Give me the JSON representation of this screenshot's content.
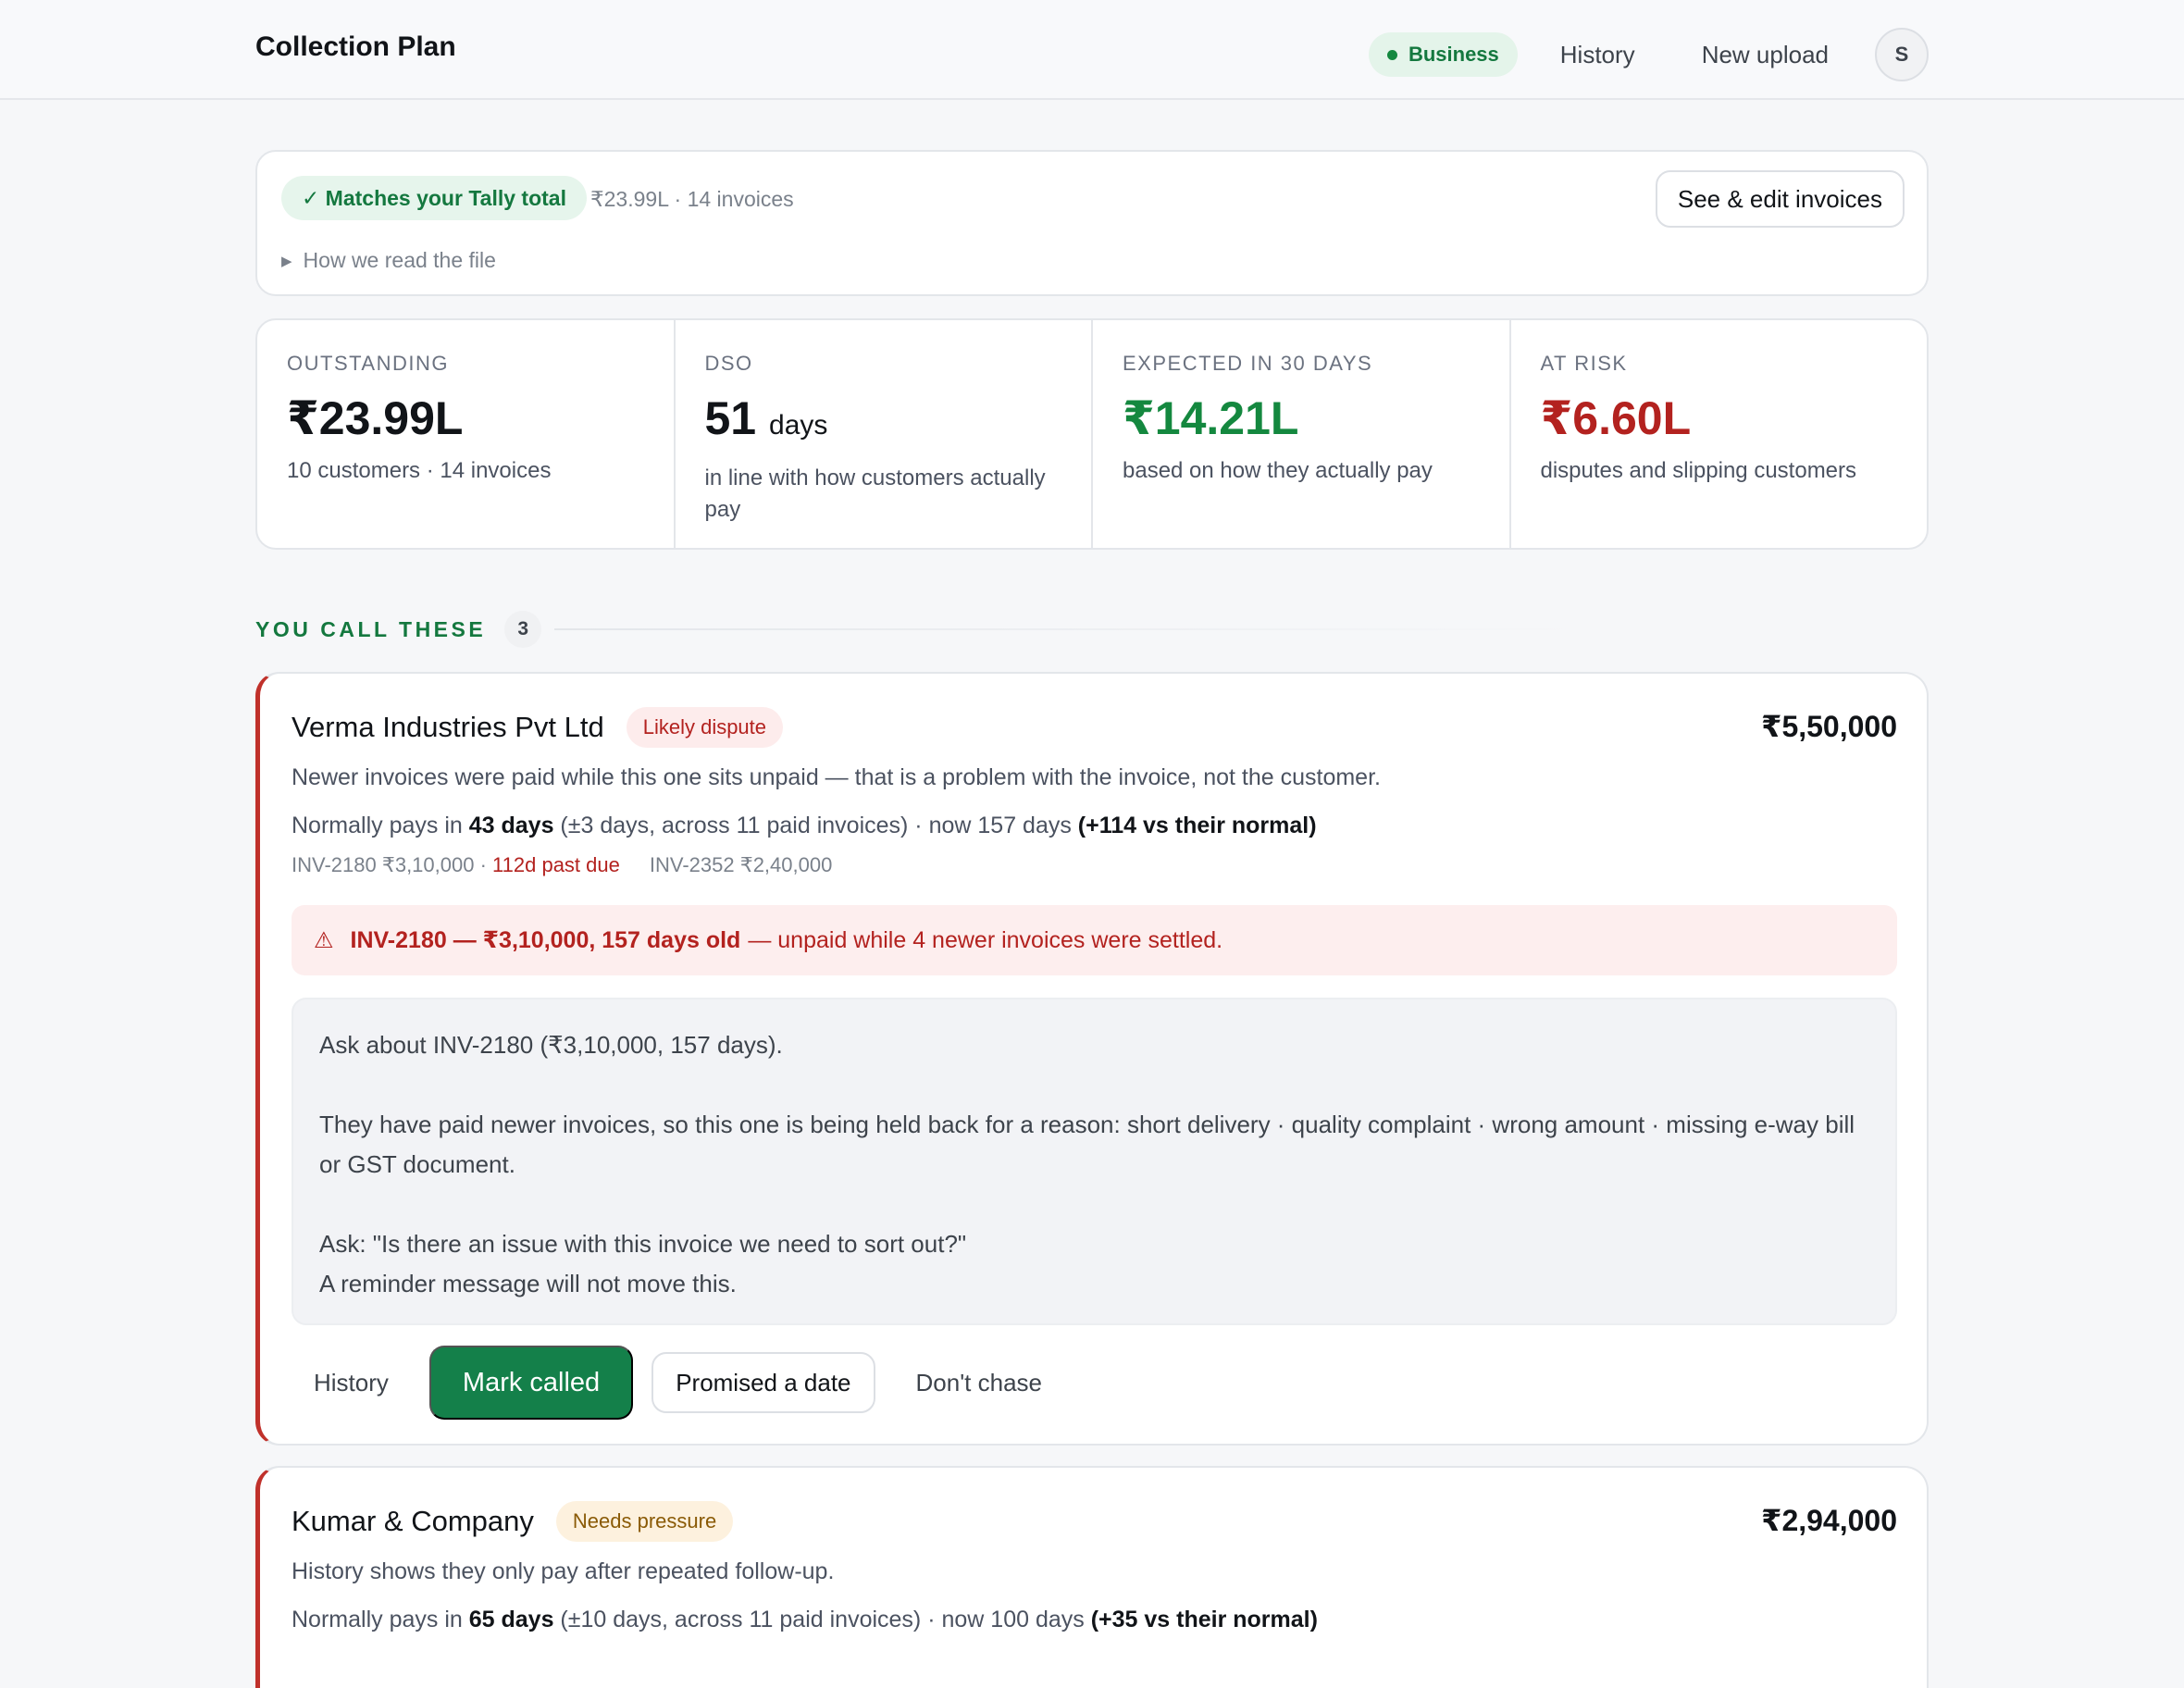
{
  "app": {
    "title": "Collection Plan"
  },
  "nav": {
    "business_label": "Business",
    "history_label": "History",
    "new_upload_label": "New upload",
    "avatar_initial": "S"
  },
  "tally": {
    "match_label": "✓ Matches your Tally total",
    "meta": "₹23.99L · 14 invoices",
    "how_read_label": "How we read the file",
    "edit_button_label": "See & edit invoices"
  },
  "stats": [
    {
      "label": "OUTSTANDING",
      "value": "₹23.99L",
      "unit": "",
      "sub": "10 customers · 14 invoices",
      "tone": "default"
    },
    {
      "label": "DSO",
      "value": "51",
      "unit": "days",
      "sub": "in line with how customers actually pay",
      "tone": "default"
    },
    {
      "label": "EXPECTED IN 30 DAYS",
      "value": "₹14.21L",
      "unit": "",
      "sub": "based on how they actually pay",
      "tone": "green"
    },
    {
      "label": "AT RISK",
      "value": "₹6.60L",
      "unit": "",
      "sub": "disputes and slipping customers",
      "tone": "red"
    }
  ],
  "section": {
    "title": "YOU CALL THESE",
    "count": "3"
  },
  "customers": [
    {
      "name": "Verma Industries Pvt Ltd",
      "tag": "Likely dispute",
      "amount": "₹5,50,000",
      "reason": "Newer invoices were paid while this one sits unpaid — that is a problem with the invoice, not the customer.",
      "pattern_prefix": "Normally pays in ",
      "pattern_days": "43 days",
      "pattern_mid": " (±3 days, across 11 paid invoices) · now 157 days ",
      "pattern_delta": "(+114 vs their normal)",
      "invoice_1": "INV-2180 ₹3,10,000 · ",
      "invoice_1_late": "112d past due",
      "invoice_2": "INV-2352 ₹2,40,000",
      "alert_icon": "⚠",
      "alert_strong": "INV-2180 — ₹3,10,000, 157 days old",
      "alert_rest": "— unpaid while 4 newer invoices were settled.",
      "script_1": "Ask about INV-2180 (₹3,10,000, 157 days).",
      "script_2": "They have paid newer invoices, so this one is being held back for a reason: short delivery · quality complaint · wrong amount · missing e-way bill or GST document.",
      "script_3": "Ask: \"Is there an issue with this invoice we need to sort out?\"\nA reminder message will not move this.",
      "actions": {
        "history": "History",
        "mark_called": "Mark called",
        "promised": "Promised a date",
        "dont_chase": "Don't chase"
      }
    },
    {
      "name": "Kumar & Company",
      "tag": "Needs pressure",
      "amount": "₹2,94,000",
      "reason": "History shows they only pay after repeated follow-up.",
      "pattern_prefix": "Normally pays in ",
      "pattern_days": "65 days",
      "pattern_mid": " (±10 days, across 11 paid invoices) · now 100 days ",
      "pattern_delta": "(+35 vs their normal)"
    }
  ],
  "colors": {
    "accent_green": "#14804a",
    "risk_red": "#b3221f",
    "card_border": "#e3e6ea"
  }
}
